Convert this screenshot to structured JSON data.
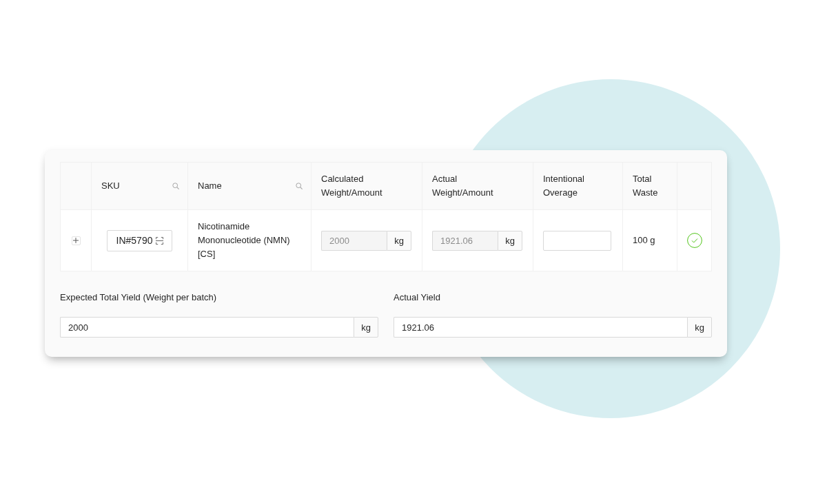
{
  "table": {
    "columns": [
      {
        "label": "SKU",
        "searchable": true
      },
      {
        "label": "Name",
        "searchable": true
      },
      {
        "label": "Calculated Weight/Amount",
        "searchable": false
      },
      {
        "label": "Actual Weight/Amount",
        "searchable": false
      },
      {
        "label": "Intentional Overage",
        "searchable": false
      },
      {
        "label": "Total Waste",
        "searchable": false
      }
    ],
    "rows": [
      {
        "expanded": false,
        "sku": "IN#5790",
        "name": "Nicotinamide Mononucleotide (NMN) [CS]",
        "calculated": {
          "value": "2000",
          "unit": "kg",
          "disabled": true
        },
        "actual": {
          "value": "1921.06",
          "unit": "kg",
          "disabled": true
        },
        "overage": {
          "disabled": false
        },
        "total_waste": "100 g",
        "verified": true
      }
    ]
  },
  "yield_fields": [
    {
      "label": "Expected Total Yield (Weight per batch)",
      "value": "2000",
      "unit": "kg"
    },
    {
      "label": "Actual Yield",
      "value": "1921.06",
      "unit": "kg"
    }
  ]
}
